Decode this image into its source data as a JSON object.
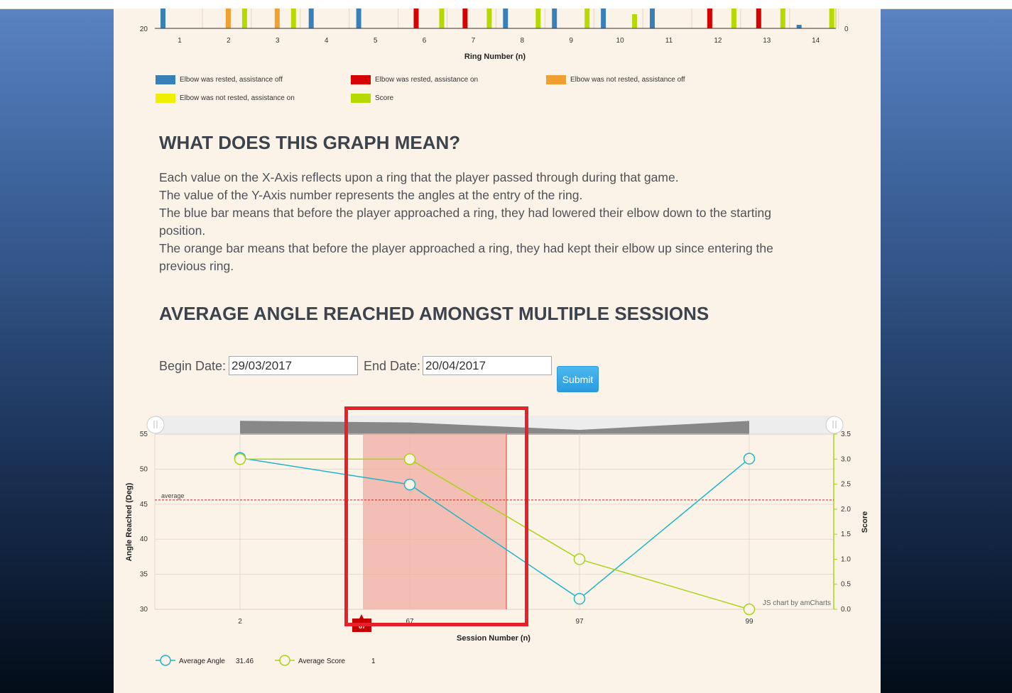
{
  "ring_chart": {
    "x_ticks": [
      "1",
      "2",
      "3",
      "4",
      "5",
      "6",
      "7",
      "8",
      "9",
      "10",
      "11",
      "12",
      "13",
      "14"
    ],
    "y_left_label": "20",
    "y_right_label": "0",
    "xlabel": "Ring Number (n)",
    "legend": [
      {
        "label": "Elbow was rested, assistance off",
        "color": "#3a80b8"
      },
      {
        "label": "Elbow was rested, assistance on",
        "color": "#d60000"
      },
      {
        "label": "Elbow was not rested, assistance off",
        "color": "#f0a030"
      },
      {
        "label": "Elbow was not rested, assistance on",
        "color": "#eef000"
      },
      {
        "label": "Score",
        "color": "#b6d900"
      }
    ]
  },
  "explanation": {
    "title": "WHAT DOES THIS GRAPH MEAN?",
    "lines": [
      "Each value on the X-Axis reflects upon a ring that the player passed through during that game.",
      "The value of the Y-Axis number represents the angles at the entry of the ring.",
      "The blue bar means that before the player approached a ring, they had lowered their elbow down to the starting position.",
      "The orange bar means that before the player approached a ring, they had kept their elbow up since entering the previous ring."
    ]
  },
  "sessions": {
    "title": "AVERAGE ANGLE REACHED AMONGST MULTIPLE SESSIONS",
    "begin_label": "Begin Date:",
    "begin_value": "29/03/2017",
    "end_label": "End Date:",
    "end_value": "20/04/2017",
    "submit_label": "Submit"
  },
  "chart_data": {
    "type": "line",
    "categories": [
      "2",
      "67",
      "97",
      "99"
    ],
    "series": [
      {
        "name": "Average Angle",
        "axis": "left",
        "color": "#1fb5c9",
        "values": [
          51.6,
          47.8,
          31.5,
          51.5
        ]
      },
      {
        "name": "Average Score",
        "axis": "right",
        "color": "#a8d414",
        "values": [
          3,
          3,
          1,
          0
        ]
      }
    ],
    "xlabel": "Session Number (n)",
    "ylabel": "Angle Reached (Deg)",
    "ylabel_right": "Score",
    "ylim": [
      30,
      55
    ],
    "ylim_right": [
      0,
      3.5
    ],
    "y_ticks": [
      "30",
      "35",
      "40",
      "45",
      "50",
      "55"
    ],
    "y_right_ticks": [
      "0.0",
      "0.5",
      "1.0",
      "1.5",
      "2.0",
      "2.5",
      "3.0",
      "3.5"
    ],
    "guide": {
      "label": "average",
      "value": 45.6
    },
    "cursor_label": "67",
    "legend_values": {
      "Average Angle": "31.46",
      "Average Score": "1"
    },
    "credit": "JS chart by amCharts",
    "legend_placement": "bottom"
  }
}
